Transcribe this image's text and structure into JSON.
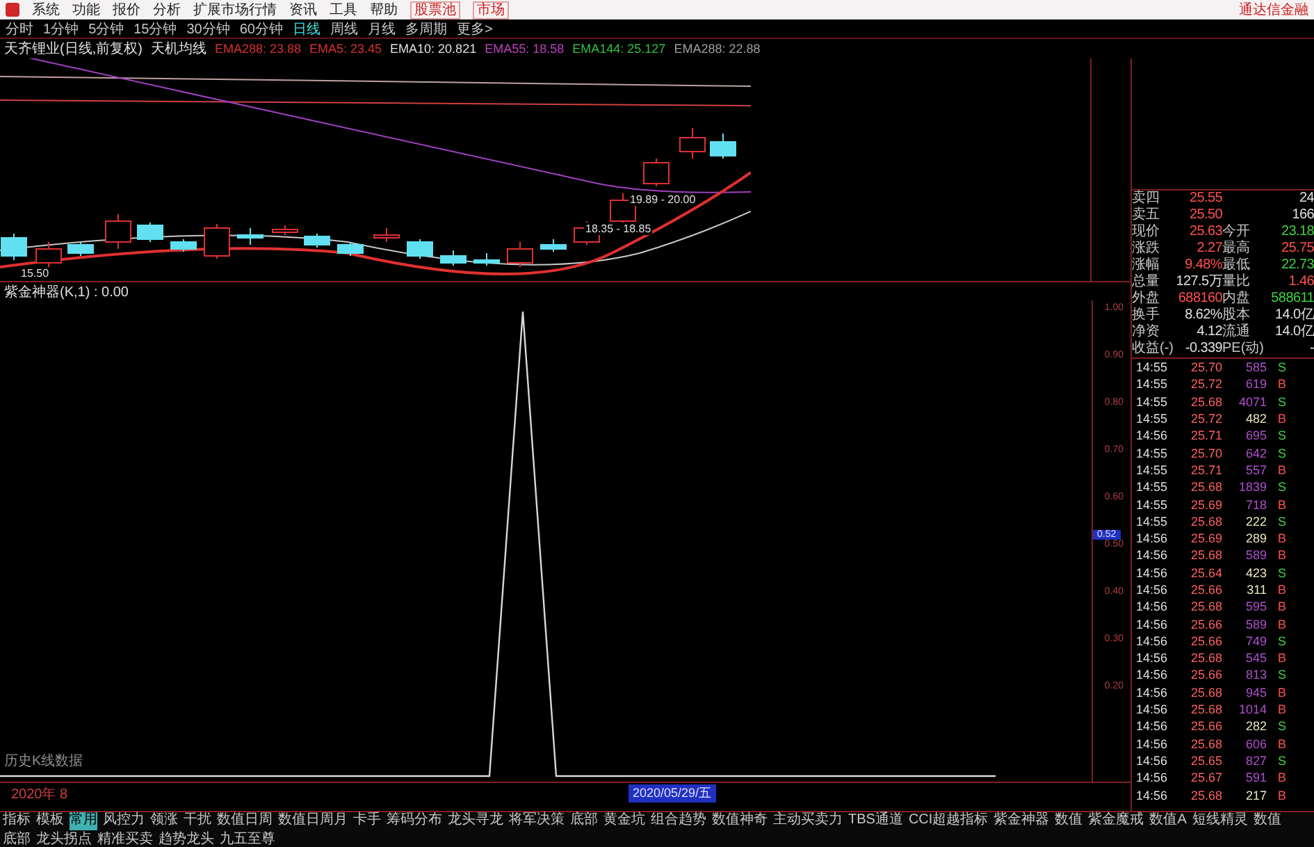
{
  "menu": {
    "items": [
      "系统",
      "功能",
      "报价",
      "分析",
      "扩展市场行情",
      "资讯",
      "工具",
      "帮助"
    ],
    "highlight_items": [
      "股票池",
      "市场"
    ],
    "brand": "通达信金融"
  },
  "periods": [
    {
      "label": "分时",
      "selected": false
    },
    {
      "label": "1分钟",
      "selected": false
    },
    {
      "label": "5分钟",
      "selected": false
    },
    {
      "label": "15分钟",
      "selected": false
    },
    {
      "label": "30分钟",
      "selected": false
    },
    {
      "label": "60分钟",
      "selected": false
    },
    {
      "label": "日线",
      "selected": true
    },
    {
      "label": "周线",
      "selected": false
    },
    {
      "label": "月线",
      "selected": false
    },
    {
      "label": "多周期",
      "selected": false
    },
    {
      "label": "更多>",
      "selected": false
    }
  ],
  "main_chart": {
    "title": "天齐锂业(日线,前复权)",
    "indicator": "天机均线",
    "lines": [
      {
        "label": "EMA288: 23.88",
        "color": "#d83030"
      },
      {
        "label": "EMA5: 23.45",
        "color": "#d83030"
      },
      {
        "label": "EMA10: 20.821",
        "color": "#e0e0e0"
      },
      {
        "label": "EMA55: 18.58",
        "color": "#c040c0"
      },
      {
        "label": "EMA144: 25.127",
        "color": "#30c040"
      },
      {
        "label": "EMA288: 22.88",
        "color": "#a0a0a0"
      }
    ],
    "annotations": [
      "19.89 - 20.00",
      "18.35 - 18.85",
      "15.50"
    ]
  },
  "sub_chart": {
    "title": "紫金神器(K,1) : 0.00",
    "axis": [
      "1.00",
      "0.90",
      "0.80",
      "0.70",
      "0.60",
      "0.50",
      "0.40",
      "0.30",
      "0.20"
    ],
    "cursor_value": "0.52",
    "note": "历史K线数据",
    "date_left": "2020年 8",
    "date_cursor": "2020/05/29/五"
  },
  "quote": [
    {
      "cells": [
        {
          "label": "卖四",
          "value": "25.55",
          "color": "#ff5050"
        },
        {
          "value": "24",
          "color": "#e0e0e0"
        }
      ]
    },
    {
      "cells": [
        {
          "label": "卖五",
          "value": "25.50",
          "color": "#ff5050"
        },
        {
          "value": "166",
          "color": "#e0e0e0"
        }
      ]
    },
    {
      "cells": [
        {
          "label": "现价",
          "value": "25.63",
          "color": "#ff5050"
        },
        {
          "label": "今开",
          "value": "23.18",
          "color": "#40d040"
        }
      ]
    },
    {
      "cells": [
        {
          "label": "涨跌",
          "value": "2.27",
          "color": "#ff5050"
        },
        {
          "label": "最高",
          "value": "25.75",
          "color": "#ff5050"
        }
      ]
    },
    {
      "cells": [
        {
          "label": "涨幅",
          "value": "9.48%",
          "color": "#ff5050"
        },
        {
          "label": "最低",
          "value": "22.73",
          "color": "#40d040"
        }
      ]
    },
    {
      "cells": [
        {
          "label": "总量",
          "value": "127.5万",
          "color": "#e0e0e0"
        },
        {
          "label": "量比",
          "value": "1.46",
          "color": "#ff5050"
        }
      ]
    },
    {
      "cells": [
        {
          "label": "外盘",
          "value": "688160",
          "color": "#ff5050"
        },
        {
          "label": "内盘",
          "value": "588611",
          "color": "#40d040"
        }
      ]
    },
    {
      "cells": [
        {
          "label": "换手",
          "value": "8.62%",
          "color": "#e0e0e0"
        },
        {
          "label": "股本",
          "value": "14.0亿",
          "color": "#e0e0e0"
        }
      ]
    },
    {
      "cells": [
        {
          "label": "净资",
          "value": "4.12",
          "color": "#e0e0e0"
        },
        {
          "label": "流通",
          "value": "14.0亿",
          "color": "#e0e0e0"
        }
      ]
    },
    {
      "cells": [
        {
          "label": "收益(-)",
          "value": "-0.339",
          "color": "#e0e0e0"
        },
        {
          "label": "PE(动)",
          "value": "-",
          "color": "#e0e0e0"
        }
      ]
    }
  ],
  "trades": [
    {
      "time": "14:55",
      "price": "25.70",
      "volume": "585",
      "side": "S",
      "kind": "sell",
      "color": "#b050d0"
    },
    {
      "time": "14:55",
      "price": "25.72",
      "volume": "619",
      "side": "B",
      "kind": "buy",
      "color": "#b050d0"
    },
    {
      "time": "14:55",
      "price": "25.68",
      "volume": "4071",
      "side": "S",
      "kind": "sell",
      "color": "#b050d0"
    },
    {
      "time": "14:55",
      "price": "25.72",
      "volume": "482",
      "side": "B",
      "kind": "buy",
      "color": "#e8e8c0"
    },
    {
      "time": "14:56",
      "price": "25.71",
      "volume": "695",
      "side": "S",
      "kind": "sell",
      "color": "#b050d0"
    },
    {
      "time": "14:55",
      "price": "25.70",
      "volume": "642",
      "side": "S",
      "kind": "sell",
      "color": "#b050d0"
    },
    {
      "time": "14:55",
      "price": "25.71",
      "volume": "557",
      "side": "B",
      "kind": "buy",
      "color": "#b050d0"
    },
    {
      "time": "14:55",
      "price": "25.68",
      "volume": "1839",
      "side": "S",
      "kind": "sell",
      "color": "#b050d0"
    },
    {
      "time": "14:55",
      "price": "25.69",
      "volume": "718",
      "side": "B",
      "kind": "buy",
      "color": "#b050d0"
    },
    {
      "time": "14:55",
      "price": "25.68",
      "volume": "222",
      "side": "S",
      "kind": "sell",
      "color": "#e8e8c0"
    },
    {
      "time": "14:56",
      "price": "25.69",
      "volume": "289",
      "side": "B",
      "kind": "buy",
      "color": "#e8e8c0"
    },
    {
      "time": "14:56",
      "price": "25.68",
      "volume": "589",
      "side": "B",
      "kind": "buy",
      "color": "#b050d0"
    },
    {
      "time": "14:56",
      "price": "25.64",
      "volume": "423",
      "side": "S",
      "kind": "sell",
      "color": "#e8e8c0"
    },
    {
      "time": "14:56",
      "price": "25.66",
      "volume": "311",
      "side": "B",
      "kind": "buy",
      "color": "#e8e8c0"
    },
    {
      "time": "14:56",
      "price": "25.68",
      "volume": "595",
      "side": "B",
      "kind": "buy",
      "color": "#b050d0"
    },
    {
      "time": "14:56",
      "price": "25.66",
      "volume": "589",
      "side": "B",
      "kind": "buy",
      "color": "#b050d0"
    },
    {
      "time": "14:56",
      "price": "25.66",
      "volume": "749",
      "side": "S",
      "kind": "sell",
      "color": "#b050d0"
    },
    {
      "time": "14:56",
      "price": "25.68",
      "volume": "545",
      "side": "B",
      "kind": "buy",
      "color": "#b050d0"
    },
    {
      "time": "14:56",
      "price": "25.66",
      "volume": "813",
      "side": "S",
      "kind": "sell",
      "color": "#b050d0"
    },
    {
      "time": "14:56",
      "price": "25.68",
      "volume": "945",
      "side": "B",
      "kind": "buy",
      "color": "#b050d0"
    },
    {
      "time": "14:56",
      "price": "25.68",
      "volume": "1014",
      "side": "B",
      "kind": "buy",
      "color": "#b050d0"
    },
    {
      "time": "14:56",
      "price": "25.66",
      "volume": "282",
      "side": "S",
      "kind": "sell",
      "color": "#e8e8c0"
    },
    {
      "time": "14:56",
      "price": "25.68",
      "volume": "606",
      "side": "B",
      "kind": "buy",
      "color": "#b050d0"
    },
    {
      "time": "14:56",
      "price": "25.65",
      "volume": "827",
      "side": "S",
      "kind": "sell",
      "color": "#b050d0"
    },
    {
      "time": "14:56",
      "price": "25.67",
      "volume": "591",
      "side": "B",
      "kind": "buy",
      "color": "#b050d0"
    },
    {
      "time": "14:56",
      "price": "25.68",
      "volume": "217",
      "side": "B",
      "kind": "buy",
      "color": "#e8e8c0"
    }
  ],
  "tabs": [
    {
      "label": "指标",
      "selected": false
    },
    {
      "label": "模板",
      "selected": false
    },
    {
      "label": "常用",
      "selected": true
    },
    {
      "label": "风控力",
      "selected": false
    },
    {
      "label": "领涨",
      "selected": false
    },
    {
      "label": "干扰",
      "selected": false
    },
    {
      "label": "数值日周",
      "selected": false
    },
    {
      "label": "数值日周月",
      "selected": false
    },
    {
      "label": "卡手",
      "selected": false
    },
    {
      "label": "筹码分布",
      "selected": false
    },
    {
      "label": "龙头寻龙",
      "selected": false
    },
    {
      "label": "将军决策",
      "selected": false
    },
    {
      "label": "底部",
      "selected": false
    },
    {
      "label": "黄金坑",
      "selected": false
    },
    {
      "label": "组合趋势",
      "selected": false
    },
    {
      "label": "数值神奇",
      "selected": false
    },
    {
      "label": "主动买卖力",
      "selected": false
    },
    {
      "label": "TBS通道",
      "selected": false
    },
    {
      "label": "CCI超越指标",
      "selected": false
    },
    {
      "label": "紫金神器",
      "selected": false
    },
    {
      "label": "数值",
      "selected": false
    },
    {
      "label": "紫金魔戒",
      "selected": false
    },
    {
      "label": "数值A",
      "selected": false
    },
    {
      "label": "短线精灵",
      "selected": false
    },
    {
      "label": "数值",
      "selected": false
    },
    {
      "label": "底部",
      "selected": false
    },
    {
      "label": "龙头拐点",
      "selected": false
    },
    {
      "label": "精准买卖",
      "selected": false
    },
    {
      "label": "趋势龙头",
      "selected": false
    },
    {
      "label": "九五至尊",
      "selected": false
    }
  ]
}
